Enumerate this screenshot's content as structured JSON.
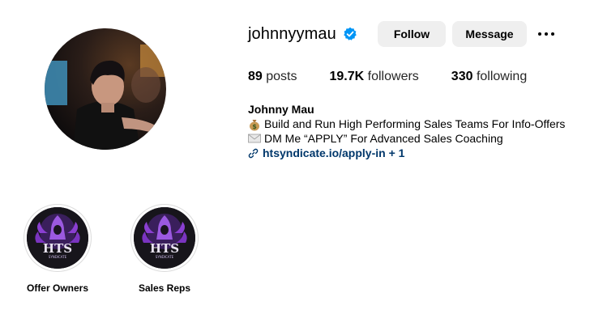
{
  "profile": {
    "username": "johnnyymau",
    "verified": true,
    "follow_label": "Follow",
    "message_label": "Message",
    "stats": {
      "posts_count": "89",
      "posts_label": "posts",
      "followers_count": "19.7K",
      "followers_label": "followers",
      "following_count": "330",
      "following_label": "following"
    },
    "bio": {
      "name": "Johnny Mau",
      "line1": "Build and Run High Performing Sales Teams For Info-Offers",
      "line1_icon": "money-bag-icon",
      "line2": "DM Me “APPLY” For Advanced Sales Coaching",
      "line2_icon": "envelope-icon",
      "link": "htsyndicate.io/apply-in + 1"
    }
  },
  "highlights": [
    {
      "label": "Offer Owners",
      "logo_text": "HTS",
      "logo_subtext": "SYNDICATE"
    },
    {
      "label": "Sales Reps",
      "logo_text": "HTS",
      "logo_subtext": "SYNDICATE"
    }
  ],
  "colors": {
    "verified_badge": "#0095f6",
    "button_bg": "#efefef",
    "link": "#00376b",
    "logo_purple": "#8a3fd1"
  }
}
